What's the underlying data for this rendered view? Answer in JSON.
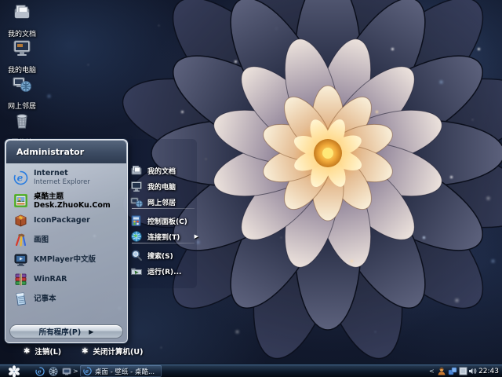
{
  "desktop": {
    "icons": [
      {
        "label": "我的文档",
        "icon": "my-documents-icon"
      },
      {
        "label": "我的电脑",
        "icon": "my-computer-icon"
      },
      {
        "label": "网上邻居",
        "icon": "network-places-icon"
      },
      {
        "label": "回收站",
        "icon": "recycle-bin-icon"
      }
    ]
  },
  "start_menu": {
    "user": "Administrator",
    "left_items": [
      {
        "label": "Internet",
        "sublabel": "Internet Explorer",
        "icon": "internet-explorer-icon"
      },
      {
        "label": "桌酷主题Desk.ZhuoKu.Com",
        "icon": "desktop-theme-icon"
      },
      {
        "label": "IconPackager",
        "icon": "iconpackager-icon"
      },
      {
        "label": "画图",
        "icon": "paint-icon"
      },
      {
        "label": "KMPlayer中文版",
        "icon": "kmplayer-icon"
      },
      {
        "label": "WinRAR",
        "icon": "winrar-icon"
      },
      {
        "label": "记事本",
        "icon": "notepad-icon"
      }
    ],
    "all_programs": {
      "label": "所有程序(P)",
      "arrow": "▶"
    },
    "right_items": [
      {
        "label": "我的文档",
        "icon": "my-documents-icon"
      },
      {
        "label": "我的电脑",
        "icon": "my-computer-icon"
      },
      {
        "label": "网上邻居",
        "icon": "network-places-icon"
      },
      {
        "label": "控制面板(C)",
        "icon": "control-panel-icon"
      },
      {
        "label": "连接到(T)",
        "icon": "connect-to-icon",
        "submenu_arrow": "▶"
      },
      {
        "label": "搜索(S)",
        "icon": "search-icon"
      },
      {
        "label": "运行(R)...",
        "icon": "run-icon"
      }
    ],
    "logoff": {
      "label": "注销(L)",
      "icon": "logoff-star-icon",
      "glyph": "✱"
    },
    "shutdown": {
      "label": "关闭计算机(U)",
      "icon": "shutdown-star-icon",
      "glyph": "✱"
    }
  },
  "taskbar": {
    "start_button": {
      "icon": "start-flower-icon"
    },
    "quick_launch_expand": ">",
    "window_button": {
      "label": "桌面 - 壁纸 - 桌酷...",
      "icon": "internet-explorer-icon"
    },
    "tray_collapse": "<",
    "clock": "22:43"
  },
  "colors": {
    "taskbar_dark": "#0e1a2b",
    "menu_header": "#3c4b62",
    "menu_glass": "#aab4c3",
    "flower_core": "#f0a838",
    "wallpaper_base": "#0c1222",
    "text_dark": "#17283c",
    "text_light": "#ffffff"
  }
}
